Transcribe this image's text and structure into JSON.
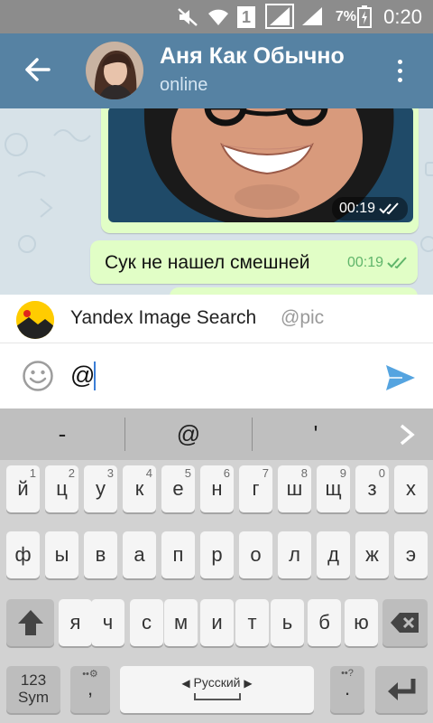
{
  "status_bar": {
    "time": "0:20",
    "battery_percent": "7%",
    "sim_badge": "1"
  },
  "header": {
    "title": "Аня Как Обычно",
    "subtitle": "online",
    "back_icon": "arrow-left-icon",
    "menu_icon": "more-vertical-icon"
  },
  "chat": {
    "messages": [
      {
        "type": "photo",
        "time": "00:19",
        "read": true
      },
      {
        "type": "text",
        "text": "Сук не нашел смешней",
        "time": "00:19",
        "read": true
      }
    ]
  },
  "mention_suggestion": {
    "name": "Yandex Image Search",
    "handle": "@pic"
  },
  "composer": {
    "text": "@",
    "emoji_icon": "smile-icon",
    "send_icon": "send-icon"
  },
  "keyboard": {
    "suggestions": [
      "-",
      "@",
      "'"
    ],
    "row1": [
      {
        "letter": "й",
        "num": "1"
      },
      {
        "letter": "ц",
        "num": "2"
      },
      {
        "letter": "у",
        "num": "3"
      },
      {
        "letter": "к",
        "num": "4"
      },
      {
        "letter": "е",
        "num": "5"
      },
      {
        "letter": "н",
        "num": "6"
      },
      {
        "letter": "г",
        "num": "7"
      },
      {
        "letter": "ш",
        "num": "8"
      },
      {
        "letter": "щ",
        "num": "9"
      },
      {
        "letter": "з",
        "num": "0"
      },
      {
        "letter": "х",
        "num": ""
      }
    ],
    "row2": [
      "ф",
      "ы",
      "в",
      "а",
      "п",
      "р",
      "о",
      "л",
      "д",
      "ж",
      "э"
    ],
    "row3": [
      "я",
      "ч",
      "с",
      "м",
      "и",
      "т",
      "ь",
      "б",
      "ю"
    ],
    "sym_label": "123\nSym",
    "comma": ",",
    "period": ".",
    "space_label": "Русский"
  },
  "colors": {
    "header": "#5682a3",
    "bubble_out": "#e1fec6",
    "check": "#5fb56a",
    "send": "#55a4e0"
  }
}
